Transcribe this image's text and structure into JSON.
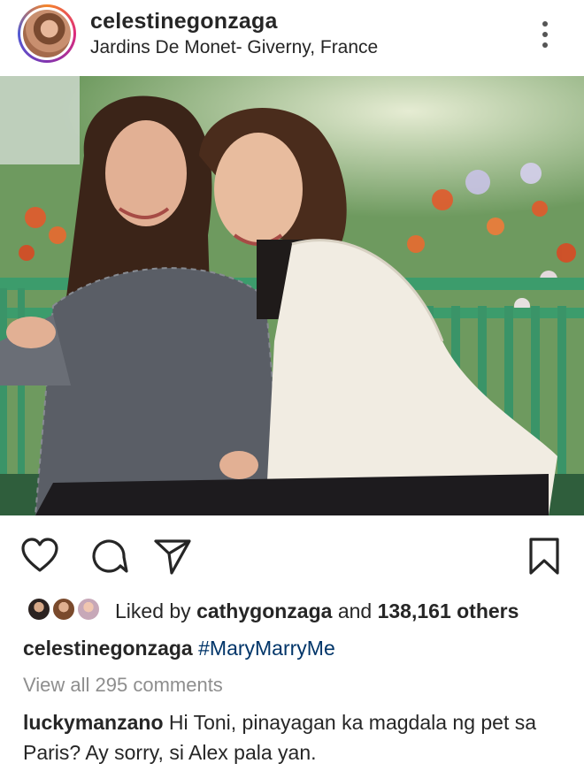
{
  "post": {
    "username": "celestinegonzaga",
    "location": "Jardins De Monet- Giverny, France",
    "icons": {
      "more": "more-vertical-icon",
      "like": "heart-icon",
      "comment": "comment-icon",
      "share": "share-send-icon",
      "save": "bookmark-icon"
    }
  },
  "likes": {
    "prefix": "Liked by",
    "user": "cathygonzaga",
    "joiner": "and",
    "count": "138,161 others"
  },
  "caption": {
    "username": "celestinegonzaga",
    "hashtag": "#MaryMarryMe"
  },
  "comments": {
    "view_all": "View all 295 comments",
    "items": [
      {
        "username": "luckymanzano",
        "text": "Hi Toni, pinayagan ka magdala ng pet sa Paris? Ay sorry, si Alex pala yan."
      }
    ]
  },
  "colors": {
    "text": "#262626",
    "muted": "#8e8e8e",
    "hashtag": "#003569"
  }
}
